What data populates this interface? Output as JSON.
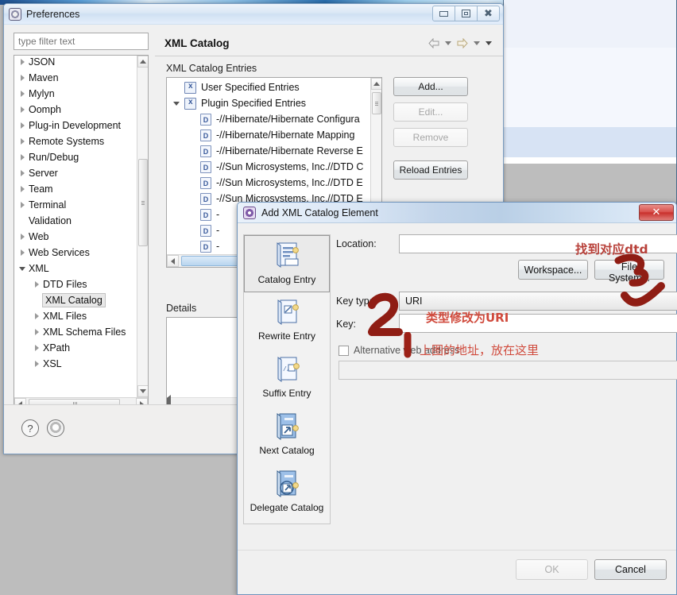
{
  "preferences_window": {
    "title": "Preferences",
    "window_buttons": {
      "minimize": "minimize-button",
      "maximize": "maximize-button",
      "close": "close-button"
    },
    "filter": {
      "placeholder": "type filter text",
      "value": ""
    },
    "tree": [
      {
        "label": "JSON",
        "level": 1,
        "expandable": true,
        "expanded": false,
        "selected": false
      },
      {
        "label": "Maven",
        "level": 1,
        "expandable": true,
        "expanded": false,
        "selected": false
      },
      {
        "label": "Mylyn",
        "level": 1,
        "expandable": true,
        "expanded": false,
        "selected": false
      },
      {
        "label": "Oomph",
        "level": 1,
        "expandable": true,
        "expanded": false,
        "selected": false
      },
      {
        "label": "Plug-in Development",
        "level": 1,
        "expandable": true,
        "expanded": false,
        "selected": false
      },
      {
        "label": "Remote Systems",
        "level": 1,
        "expandable": true,
        "expanded": false,
        "selected": false
      },
      {
        "label": "Run/Debug",
        "level": 1,
        "expandable": true,
        "expanded": false,
        "selected": false
      },
      {
        "label": "Server",
        "level": 1,
        "expandable": true,
        "expanded": false,
        "selected": false
      },
      {
        "label": "Team",
        "level": 1,
        "expandable": true,
        "expanded": false,
        "selected": false
      },
      {
        "label": "Terminal",
        "level": 1,
        "expandable": true,
        "expanded": false,
        "selected": false
      },
      {
        "label": "Validation",
        "level": 1,
        "expandable": false,
        "expanded": false,
        "selected": false
      },
      {
        "label": "Web",
        "level": 1,
        "expandable": true,
        "expanded": false,
        "selected": false
      },
      {
        "label": "Web Services",
        "level": 1,
        "expandable": true,
        "expanded": false,
        "selected": false
      },
      {
        "label": "XML",
        "level": 1,
        "expandable": true,
        "expanded": true,
        "selected": false
      },
      {
        "label": "DTD Files",
        "level": 2,
        "expandable": true,
        "expanded": false,
        "selected": false
      },
      {
        "label": "XML Catalog",
        "level": 2,
        "expandable": false,
        "expanded": false,
        "selected": true
      },
      {
        "label": "XML Files",
        "level": 2,
        "expandable": true,
        "expanded": false,
        "selected": false
      },
      {
        "label": "XML Schema Files",
        "level": 2,
        "expandable": true,
        "expanded": false,
        "selected": false
      },
      {
        "label": "XPath",
        "level": 2,
        "expandable": true,
        "expanded": false,
        "selected": false
      },
      {
        "label": "XSL",
        "level": 2,
        "expandable": true,
        "expanded": false,
        "selected": false
      }
    ],
    "page_title": "XML Catalog",
    "nav": {
      "back_icon": "back-arrow-icon",
      "forward_icon": "forward-arrow-icon",
      "menu_icon": "view-menu-icon"
    },
    "entries_group_label": "XML Catalog Entries",
    "entries": [
      {
        "label": "User Specified Entries",
        "icon": "catalog-icon",
        "level": 1,
        "expandable": false,
        "expanded": false
      },
      {
        "label": "Plugin Specified Entries",
        "icon": "catalog-icon",
        "level": 1,
        "expandable": true,
        "expanded": true
      },
      {
        "label": "-//Hibernate/Hibernate Configura",
        "icon": "dtd-icon",
        "level": 2
      },
      {
        "label": "-//Hibernate/Hibernate Mapping",
        "icon": "dtd-icon",
        "level": 2
      },
      {
        "label": "-//Hibernate/Hibernate Reverse E",
        "icon": "dtd-icon",
        "level": 2
      },
      {
        "label": "-//Sun Microsystems, Inc.//DTD C",
        "icon": "dtd-icon",
        "level": 2
      },
      {
        "label": "-//Sun Microsystems, Inc.//DTD E",
        "icon": "dtd-icon",
        "level": 2
      },
      {
        "label": "-//Sun Microsystems, Inc.//DTD E",
        "icon": "dtd-icon",
        "level": 2
      },
      {
        "label": "-",
        "icon": "dtd-icon",
        "level": 2
      },
      {
        "label": "-",
        "icon": "dtd-icon",
        "level": 2
      },
      {
        "label": "-",
        "icon": "dtd-icon",
        "level": 2
      }
    ],
    "side_buttons": [
      {
        "label": "Add...",
        "enabled": true
      },
      {
        "label": "Edit...",
        "enabled": false
      },
      {
        "label": "Remove",
        "enabled": false
      },
      {
        "label": "Reload Entries",
        "enabled": true
      }
    ],
    "details_label": "Details",
    "footer": {
      "help_icon": "help-icon",
      "apply_icon": "apply-settings-icon"
    }
  },
  "add_dialog": {
    "title": "Add XML Catalog Element",
    "close_label": "✕",
    "types": [
      {
        "label": "Catalog Entry",
        "icon": "catalog-entry-icon",
        "selected": true
      },
      {
        "label": "Rewrite Entry",
        "icon": "rewrite-entry-icon",
        "selected": false
      },
      {
        "label": "Suffix Entry",
        "icon": "suffix-entry-icon",
        "selected": false
      },
      {
        "label": "Next Catalog",
        "icon": "next-catalog-icon",
        "selected": false
      },
      {
        "label": "Delegate Catalog",
        "icon": "delegate-catalog-icon",
        "selected": false
      }
    ],
    "form": {
      "location_label": "Location:",
      "location_value": "",
      "workspace_button": "Workspace...",
      "filesystem_button": "File System...",
      "key_type_label": "Key type:",
      "key_type_value": "URI",
      "key_label": "Key:",
      "key_value": "",
      "alt_web_label": "Alternative web address:",
      "alt_web_checked": false,
      "alt_web_value": ""
    },
    "buttons": {
      "ok": "OK",
      "ok_enabled": false,
      "cancel": "Cancel",
      "cancel_enabled": true
    }
  },
  "annotations": {
    "dtd_note": "找到对应dtd",
    "mark_3": "3",
    "mark_2": "2",
    "uri_note": "类型修改为URI",
    "address_note": "上图的地址，放在这里",
    "color": "#c0392b"
  }
}
